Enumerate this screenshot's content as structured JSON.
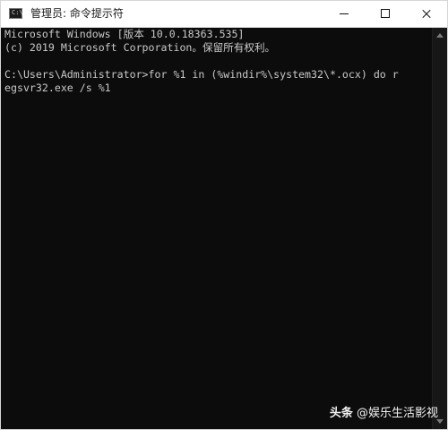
{
  "window": {
    "title": "管理员: 命令提示符",
    "icon": "console-icon",
    "icon_glyph": "C:\\"
  },
  "console": {
    "lines": [
      "Microsoft Windows [版本 10.0.18363.535]",
      "(c) 2019 Microsoft Corporation。保留所有权利。",
      "",
      "C:\\Users\\Administrator>for %1 in (%windir%\\system32\\*.ocx) do r",
      "egsvr32.exe /s %1"
    ]
  },
  "watermark": {
    "brand": "头条",
    "handle": "@娱乐生活影视"
  },
  "colors": {
    "console_bg": "#0c0c0c",
    "console_text": "#c8c8c8",
    "titlebar_bg": "#ffffff"
  }
}
